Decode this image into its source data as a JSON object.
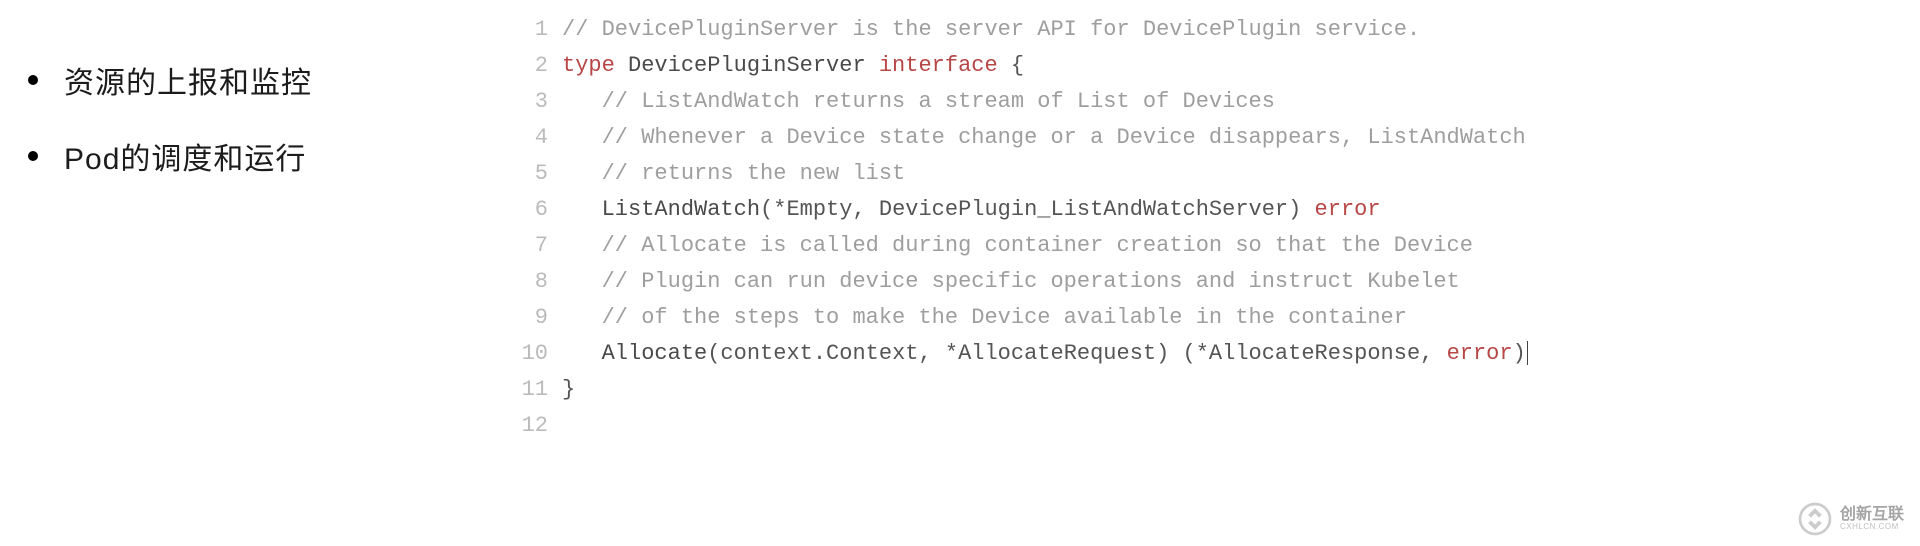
{
  "bullets": [
    {
      "text": "资源的上报和监控"
    },
    {
      "text": "Pod的调度和运行"
    }
  ],
  "code_lines": [
    {
      "n": "1",
      "tokens": [
        {
          "cls": "tok-comment",
          "t": "// DevicePluginServer is the server API for DevicePlugin service."
        }
      ]
    },
    {
      "n": "2",
      "tokens": [
        {
          "cls": "tok-keyword",
          "t": "type "
        },
        {
          "cls": "tok-ident",
          "t": "DevicePluginServer "
        },
        {
          "cls": "tok-keyword",
          "t": "interface"
        },
        {
          "cls": "tok-plain",
          "t": " {"
        }
      ]
    },
    {
      "n": "3",
      "tokens": [
        {
          "cls": "tok-plain",
          "t": "   "
        },
        {
          "cls": "tok-comment",
          "t": "// ListAndWatch returns a stream of List of Devices"
        }
      ]
    },
    {
      "n": "4",
      "tokens": [
        {
          "cls": "tok-plain",
          "t": "   "
        },
        {
          "cls": "tok-comment",
          "t": "// Whenever a Device state change or a Device disappears, ListAndWatch"
        }
      ]
    },
    {
      "n": "5",
      "tokens": [
        {
          "cls": "tok-plain",
          "t": "   "
        },
        {
          "cls": "tok-comment",
          "t": "// returns the new list"
        }
      ]
    },
    {
      "n": "6",
      "tokens": [
        {
          "cls": "tok-plain",
          "t": "   "
        },
        {
          "cls": "tok-ident",
          "t": "ListAndWatch"
        },
        {
          "cls": "tok-plain",
          "t": "(*Empty, DevicePlugin_ListAndWatchServer) "
        },
        {
          "cls": "tok-keyword",
          "t": "error"
        }
      ]
    },
    {
      "n": "7",
      "tokens": [
        {
          "cls": "tok-plain",
          "t": "   "
        },
        {
          "cls": "tok-comment",
          "t": "// Allocate is called during container creation so that the Device"
        }
      ]
    },
    {
      "n": "8",
      "tokens": [
        {
          "cls": "tok-plain",
          "t": "   "
        },
        {
          "cls": "tok-comment",
          "t": "// Plugin can run device specific operations and instruct Kubelet"
        }
      ]
    },
    {
      "n": "9",
      "tokens": [
        {
          "cls": "tok-plain",
          "t": "   "
        },
        {
          "cls": "tok-comment",
          "t": "// of the steps to make the Device available in the container"
        }
      ]
    },
    {
      "n": "10",
      "tokens": [
        {
          "cls": "tok-plain",
          "t": "   "
        },
        {
          "cls": "tok-ident",
          "t": "Allocate"
        },
        {
          "cls": "tok-plain",
          "t": "(context.Context, *AllocateRequest) (*AllocateResponse, "
        },
        {
          "cls": "tok-keyword",
          "t": "error"
        },
        {
          "cls": "tok-plain",
          "t": ")"
        }
      ],
      "cursor": true
    },
    {
      "n": "11",
      "tokens": [
        {
          "cls": "tok-plain",
          "t": "}"
        }
      ]
    },
    {
      "n": "12",
      "tokens": [
        {
          "cls": "tok-plain",
          "t": ""
        }
      ]
    }
  ],
  "watermark": {
    "brand_cn": "创新互联",
    "brand_en": "CXHLCN.COM"
  }
}
